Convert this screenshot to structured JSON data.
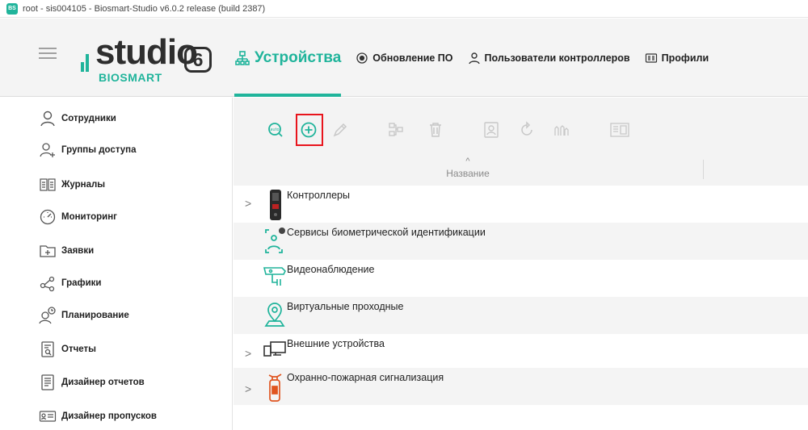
{
  "window": {
    "title": "root - sis004105 - Biosmart-Studio v6.0.2 release (build 2387)",
    "app_icon_text": "BS"
  },
  "logo": {
    "wordmark": "studio",
    "version": "6",
    "subtitle": "BIOSMART"
  },
  "tabs": [
    {
      "label": "Устройства",
      "icon": "devices-icon",
      "active": true
    },
    {
      "label": "Обновление ПО",
      "icon": "update-icon",
      "active": false
    },
    {
      "label": "Пользователи контроллеров",
      "icon": "user-icon",
      "active": false
    },
    {
      "label": "Профили",
      "icon": "profile-card-icon",
      "active": false
    }
  ],
  "sidebar": {
    "items": [
      {
        "label": "Сотрудники",
        "icon": "person-icon"
      },
      {
        "label": "Группы доступа",
        "icon": "group-add-icon"
      },
      {
        "label": "Журналы",
        "icon": "book-icon"
      },
      {
        "label": "Мониторинг",
        "icon": "gauge-icon"
      },
      {
        "label": "Заявки",
        "icon": "folder-plus-icon"
      },
      {
        "label": "Графики",
        "icon": "share-nodes-icon"
      },
      {
        "label": "Планирование",
        "icon": "person-clock-icon"
      },
      {
        "label": "Отчеты",
        "icon": "report-search-icon"
      },
      {
        "label": "Дизайнер отчетов",
        "icon": "report-designer-icon"
      },
      {
        "label": "Дизайнер пропусков",
        "icon": "badge-designer-icon"
      }
    ]
  },
  "toolbar": {
    "buttons": [
      {
        "name": "auto-search-icon",
        "text": "auto",
        "enabled": true
      },
      {
        "name": "add-icon",
        "enabled": true,
        "highlighted": true
      },
      {
        "name": "edit-icon",
        "enabled": false
      },
      {
        "name": "network-icon",
        "enabled": false
      },
      {
        "name": "delete-icon",
        "enabled": false
      },
      {
        "name": "person-frame-icon",
        "enabled": false
      },
      {
        "name": "refresh-icon",
        "enabled": false
      },
      {
        "name": "hands-icon",
        "enabled": false
      },
      {
        "name": "panel-icon",
        "enabled": false
      }
    ]
  },
  "table": {
    "sort_indicator": "^",
    "column": "Название",
    "rows": [
      {
        "label": "Контроллеры",
        "icon": "controller-device-icon",
        "expandable": true
      },
      {
        "label": "Сервисы биометрической идентификации",
        "icon": "face-scan-icon",
        "expandable": false
      },
      {
        "label": "Видеонаблюдение",
        "icon": "cctv-camera-icon",
        "expandable": false
      },
      {
        "label": "Виртуальные проходные",
        "icon": "location-pin-icon",
        "expandable": false
      },
      {
        "label": "Внешние устройства",
        "icon": "external-devices-icon",
        "expandable": true
      },
      {
        "label": "Охранно-пожарная сигнализация",
        "icon": "fire-extinguisher-icon",
        "expandable": true
      }
    ],
    "expand_glyph": ">"
  },
  "colors": {
    "accent": "#20b49b",
    "highlight_border": "#e8141c",
    "disabled_icon": "#c8c8c8"
  }
}
